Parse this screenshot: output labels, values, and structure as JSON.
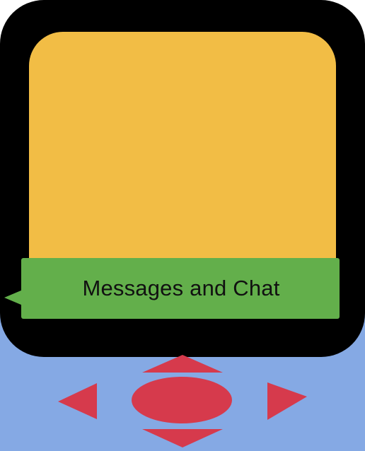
{
  "banner": {
    "label": "Messages and Chat"
  },
  "colors": {
    "frame": "#000000",
    "screen": "#F2BD45",
    "banner": "#63AF4B",
    "pad_background": "#85A9E4",
    "controls": "#D63A4C"
  },
  "controls": {
    "up_icon": "triangle-up",
    "down_icon": "triangle-down",
    "left_icon": "triangle-left",
    "right_icon": "triangle-right",
    "center_icon": "ellipse"
  }
}
